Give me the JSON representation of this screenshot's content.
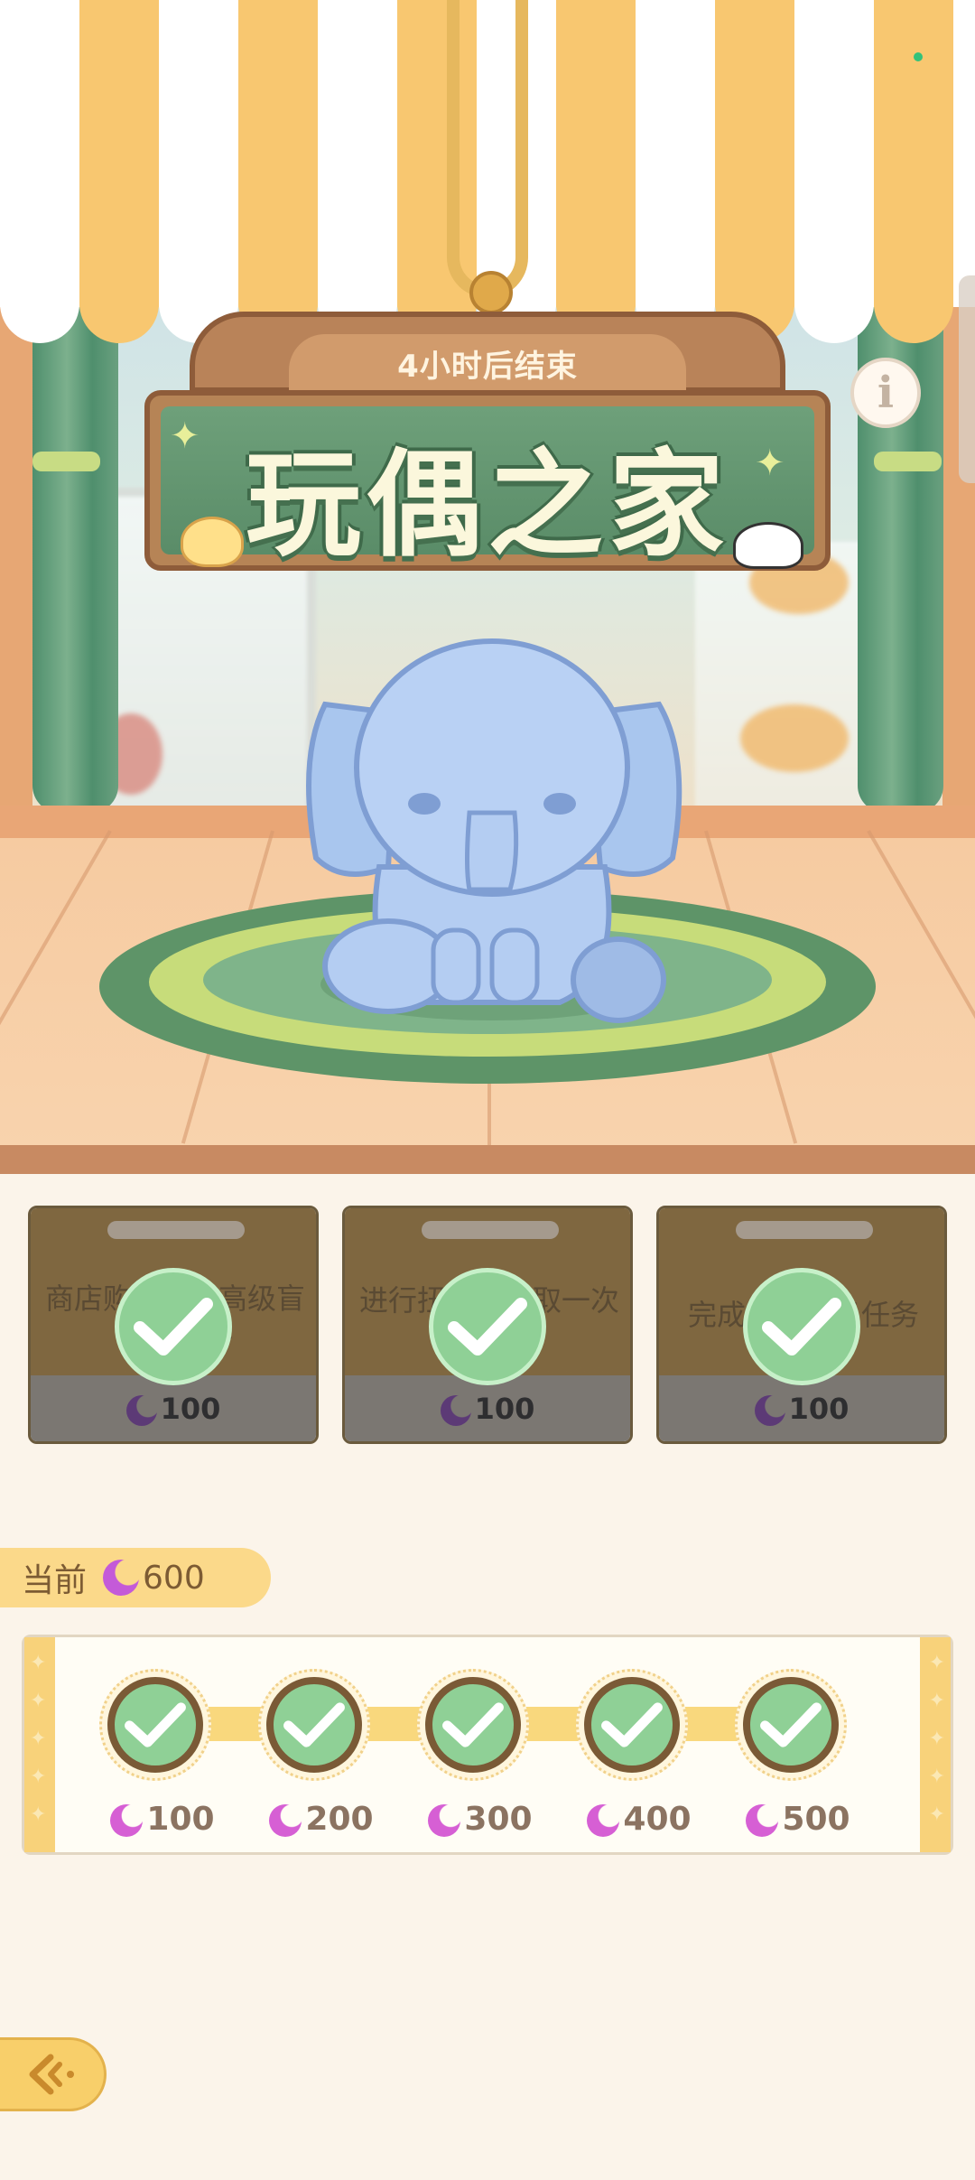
{
  "header": {
    "timer_text": "4小时后结束",
    "title": "玩偶之家"
  },
  "tasks": [
    {
      "text": "商店购买一次高级盲盒玩偶券",
      "reward": "100",
      "completed": true
    },
    {
      "text": "进行扭蛋机领取一次",
      "reward": "100",
      "completed": true
    },
    {
      "text": "完成抽奖每日任务",
      "reward": "100",
      "completed": true
    }
  ],
  "progress": {
    "current_label": "当前",
    "current_value": "600",
    "milestones": [
      {
        "value": "100",
        "completed": true
      },
      {
        "value": "200",
        "completed": true
      },
      {
        "value": "300",
        "completed": true
      },
      {
        "value": "400",
        "completed": true
      },
      {
        "value": "500",
        "completed": true
      }
    ]
  },
  "icons": {
    "info": "info-icon",
    "currency": "moon-icon",
    "check": "check-icon",
    "back": "back-arrow-icon"
  },
  "colors": {
    "accent": "#f8cf6a",
    "check_green": "#8fd096",
    "sign_green": "#5a8c68",
    "currency_purple": "#c45ad8"
  }
}
